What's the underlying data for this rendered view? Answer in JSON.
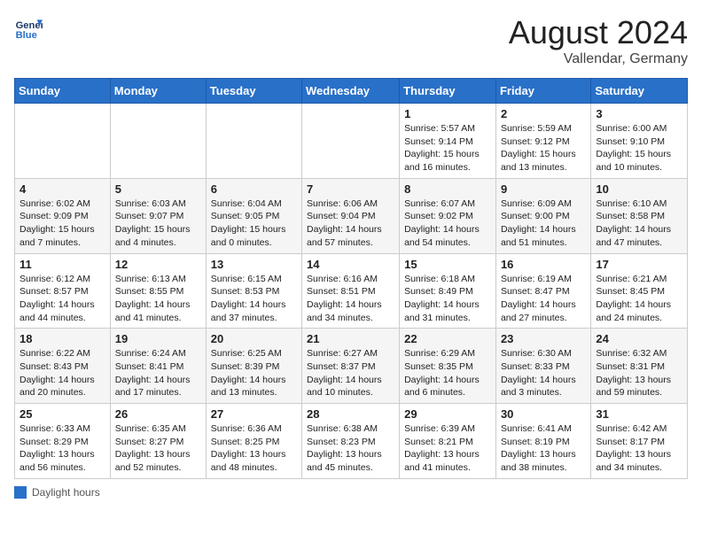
{
  "header": {
    "logo_general": "General",
    "logo_blue": "Blue",
    "month_year": "August 2024",
    "location": "Vallendar, Germany"
  },
  "days_of_week": [
    "Sunday",
    "Monday",
    "Tuesday",
    "Wednesday",
    "Thursday",
    "Friday",
    "Saturday"
  ],
  "weeks": [
    [
      {
        "day": "",
        "info": ""
      },
      {
        "day": "",
        "info": ""
      },
      {
        "day": "",
        "info": ""
      },
      {
        "day": "",
        "info": ""
      },
      {
        "day": "1",
        "info": "Sunrise: 5:57 AM\nSunset: 9:14 PM\nDaylight: 15 hours and 16 minutes."
      },
      {
        "day": "2",
        "info": "Sunrise: 5:59 AM\nSunset: 9:12 PM\nDaylight: 15 hours and 13 minutes."
      },
      {
        "day": "3",
        "info": "Sunrise: 6:00 AM\nSunset: 9:10 PM\nDaylight: 15 hours and 10 minutes."
      }
    ],
    [
      {
        "day": "4",
        "info": "Sunrise: 6:02 AM\nSunset: 9:09 PM\nDaylight: 15 hours and 7 minutes."
      },
      {
        "day": "5",
        "info": "Sunrise: 6:03 AM\nSunset: 9:07 PM\nDaylight: 15 hours and 4 minutes."
      },
      {
        "day": "6",
        "info": "Sunrise: 6:04 AM\nSunset: 9:05 PM\nDaylight: 15 hours and 0 minutes."
      },
      {
        "day": "7",
        "info": "Sunrise: 6:06 AM\nSunset: 9:04 PM\nDaylight: 14 hours and 57 minutes."
      },
      {
        "day": "8",
        "info": "Sunrise: 6:07 AM\nSunset: 9:02 PM\nDaylight: 14 hours and 54 minutes."
      },
      {
        "day": "9",
        "info": "Sunrise: 6:09 AM\nSunset: 9:00 PM\nDaylight: 14 hours and 51 minutes."
      },
      {
        "day": "10",
        "info": "Sunrise: 6:10 AM\nSunset: 8:58 PM\nDaylight: 14 hours and 47 minutes."
      }
    ],
    [
      {
        "day": "11",
        "info": "Sunrise: 6:12 AM\nSunset: 8:57 PM\nDaylight: 14 hours and 44 minutes."
      },
      {
        "day": "12",
        "info": "Sunrise: 6:13 AM\nSunset: 8:55 PM\nDaylight: 14 hours and 41 minutes."
      },
      {
        "day": "13",
        "info": "Sunrise: 6:15 AM\nSunset: 8:53 PM\nDaylight: 14 hours and 37 minutes."
      },
      {
        "day": "14",
        "info": "Sunrise: 6:16 AM\nSunset: 8:51 PM\nDaylight: 14 hours and 34 minutes."
      },
      {
        "day": "15",
        "info": "Sunrise: 6:18 AM\nSunset: 8:49 PM\nDaylight: 14 hours and 31 minutes."
      },
      {
        "day": "16",
        "info": "Sunrise: 6:19 AM\nSunset: 8:47 PM\nDaylight: 14 hours and 27 minutes."
      },
      {
        "day": "17",
        "info": "Sunrise: 6:21 AM\nSunset: 8:45 PM\nDaylight: 14 hours and 24 minutes."
      }
    ],
    [
      {
        "day": "18",
        "info": "Sunrise: 6:22 AM\nSunset: 8:43 PM\nDaylight: 14 hours and 20 minutes."
      },
      {
        "day": "19",
        "info": "Sunrise: 6:24 AM\nSunset: 8:41 PM\nDaylight: 14 hours and 17 minutes."
      },
      {
        "day": "20",
        "info": "Sunrise: 6:25 AM\nSunset: 8:39 PM\nDaylight: 14 hours and 13 minutes."
      },
      {
        "day": "21",
        "info": "Sunrise: 6:27 AM\nSunset: 8:37 PM\nDaylight: 14 hours and 10 minutes."
      },
      {
        "day": "22",
        "info": "Sunrise: 6:29 AM\nSunset: 8:35 PM\nDaylight: 14 hours and 6 minutes."
      },
      {
        "day": "23",
        "info": "Sunrise: 6:30 AM\nSunset: 8:33 PM\nDaylight: 14 hours and 3 minutes."
      },
      {
        "day": "24",
        "info": "Sunrise: 6:32 AM\nSunset: 8:31 PM\nDaylight: 13 hours and 59 minutes."
      }
    ],
    [
      {
        "day": "25",
        "info": "Sunrise: 6:33 AM\nSunset: 8:29 PM\nDaylight: 13 hours and 56 minutes."
      },
      {
        "day": "26",
        "info": "Sunrise: 6:35 AM\nSunset: 8:27 PM\nDaylight: 13 hours and 52 minutes."
      },
      {
        "day": "27",
        "info": "Sunrise: 6:36 AM\nSunset: 8:25 PM\nDaylight: 13 hours and 48 minutes."
      },
      {
        "day": "28",
        "info": "Sunrise: 6:38 AM\nSunset: 8:23 PM\nDaylight: 13 hours and 45 minutes."
      },
      {
        "day": "29",
        "info": "Sunrise: 6:39 AM\nSunset: 8:21 PM\nDaylight: 13 hours and 41 minutes."
      },
      {
        "day": "30",
        "info": "Sunrise: 6:41 AM\nSunset: 8:19 PM\nDaylight: 13 hours and 38 minutes."
      },
      {
        "day": "31",
        "info": "Sunrise: 6:42 AM\nSunset: 8:17 PM\nDaylight: 13 hours and 34 minutes."
      }
    ]
  ],
  "footer": {
    "label": "Daylight hours"
  }
}
